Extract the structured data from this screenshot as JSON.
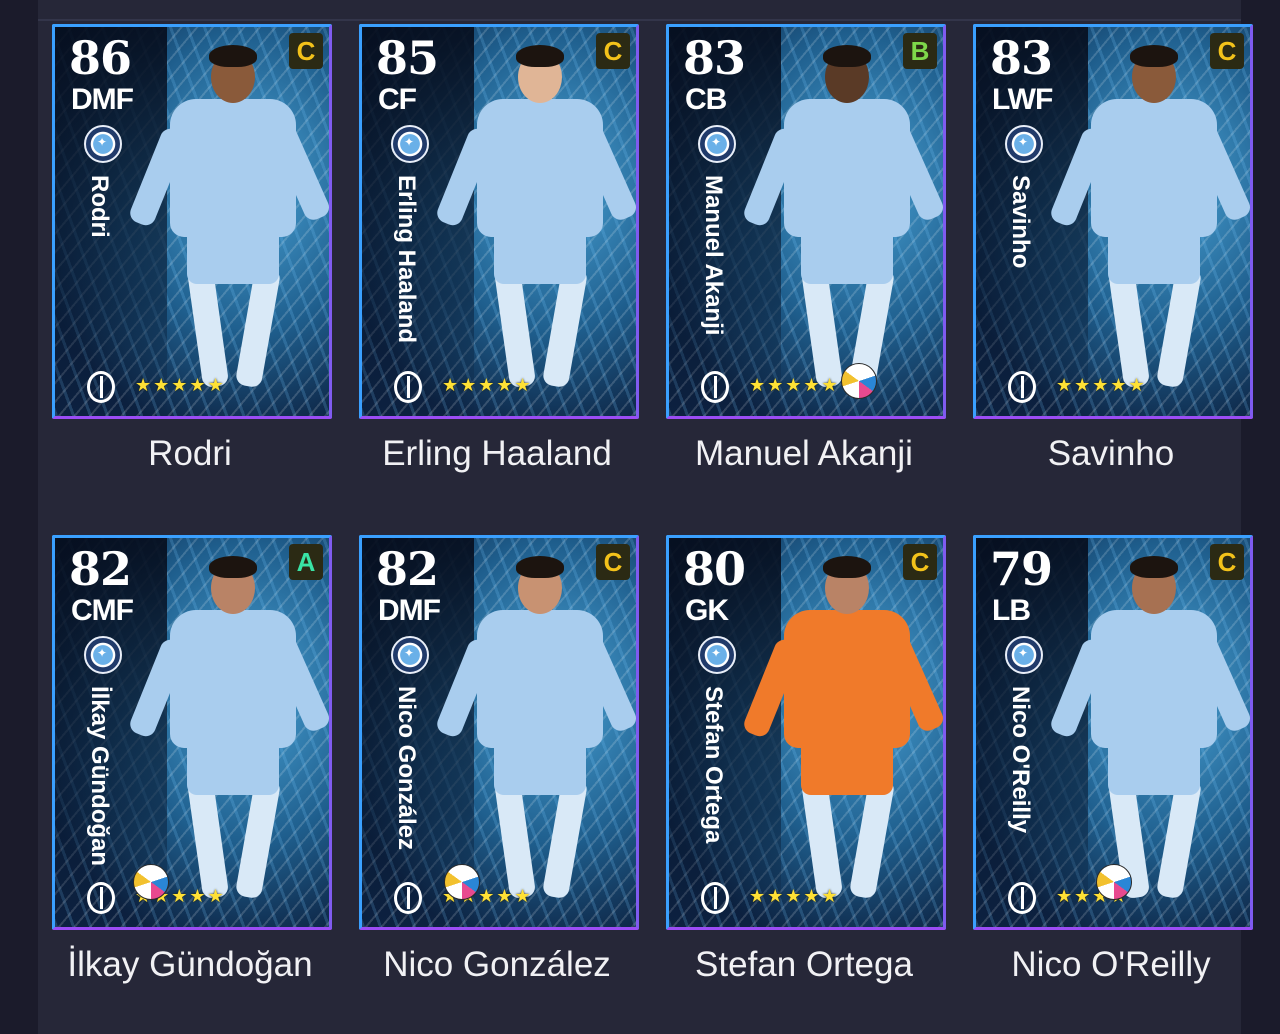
{
  "colors": {
    "grade_c": "#f3c21a",
    "grade_b": "#7ed84a",
    "grade_a": "#39e3a5",
    "star": "#ffe135",
    "card_border_top": "#3aa0ff",
    "card_border_bottom": "#9b4df5"
  },
  "players": [
    {
      "rating": "86",
      "position": "DMF",
      "grade": "C",
      "card_name": "Rodri",
      "caption": "Rodri",
      "stars": "★★★★★",
      "kit": "#a9cdee",
      "skin": "#8a5a3a"
    },
    {
      "rating": "85",
      "position": "CF",
      "grade": "C",
      "card_name": "Erling Haaland",
      "caption": "Erling Haaland",
      "stars": "★★★★★",
      "kit": "#a9cdee",
      "skin": "#e0b596"
    },
    {
      "rating": "83",
      "position": "CB",
      "grade": "B",
      "card_name": "Manuel Akanji",
      "caption": "Manuel Akanji",
      "stars": "★★★★★",
      "kit": "#a9cdee",
      "skin": "#5a3a26"
    },
    {
      "rating": "83",
      "position": "LWF",
      "grade": "C",
      "card_name": "Savinho",
      "caption": "Savinho",
      "stars": "★★★★★",
      "kit": "#a9cdee",
      "skin": "#8a5a3a"
    },
    {
      "rating": "82",
      "position": "CMF",
      "grade": "A",
      "card_name": "İlkay Gündoğan",
      "caption": "İlkay Gündoğan",
      "stars": "★★★★★",
      "kit": "#a9cdee",
      "skin": "#b98366"
    },
    {
      "rating": "82",
      "position": "DMF",
      "grade": "C",
      "card_name": "Nico González",
      "caption": "Nico González",
      "stars": "★★★★★",
      "kit": "#a9cdee",
      "skin": "#c89272"
    },
    {
      "rating": "80",
      "position": "GK",
      "grade": "C",
      "card_name": "Stefan Ortega",
      "caption": "Stefan Ortega",
      "stars": "★★★★★",
      "kit": "#f07a2a",
      "skin": "#b98366"
    },
    {
      "rating": "79",
      "position": "LB",
      "grade": "C",
      "card_name": "Nico O'Reilly",
      "caption": "Nico O'Reilly",
      "stars": "★★★★",
      "kit": "#a9cdee",
      "skin": "#a77152"
    }
  ]
}
